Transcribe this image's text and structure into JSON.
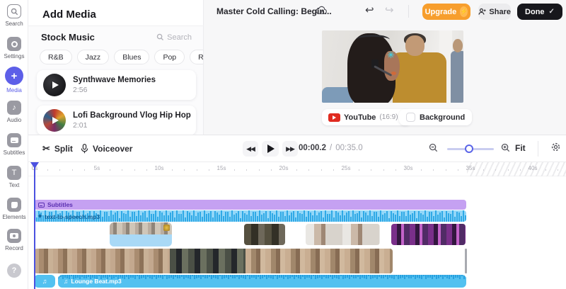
{
  "sidebar": {
    "items": [
      {
        "label": "Search"
      },
      {
        "label": "Settings"
      },
      {
        "label": "Media"
      },
      {
        "label": "Audio"
      },
      {
        "label": "Subtitles"
      },
      {
        "label": "Text"
      },
      {
        "label": "Elements"
      },
      {
        "label": "Record"
      }
    ],
    "help_label": "?"
  },
  "media_panel": {
    "title": "Add Media",
    "section_title": "Stock Music",
    "search_label": "Search",
    "genres": [
      "R&B",
      "Jazz",
      "Blues",
      "Pop",
      "Rock"
    ],
    "more_label": "•••",
    "items": [
      {
        "title": "Synthwave Memories",
        "duration": "2:56"
      },
      {
        "title": "Lofi Background Vlog Hip Hop",
        "duration": "2:01"
      }
    ]
  },
  "header": {
    "project_title": "Master Cold Calling: Begin...",
    "upgrade_label": "Upgrade",
    "upgrade_bolt": "⚡",
    "share_label": "Share",
    "done_label": "Done",
    "done_check": "✓",
    "undo_glyph": "↩",
    "redo_glyph": "↪"
  },
  "preview": {
    "format_label": "YouTube",
    "aspect_label": "(16:9)",
    "chevron": "▾",
    "background_label": "Background",
    "sticker_glyph": "✳"
  },
  "timeline": {
    "split_label": "Split",
    "split_icon": "✂",
    "voiceover_label": "Voiceover",
    "rewind_glyph": "◀◀",
    "forward_glyph": "▶▶",
    "current_time": "00:00.2",
    "time_separator": "/",
    "total_time": "00:35.0",
    "fit_label": "Fit",
    "ruler_labels": [
      "0s",
      "5s",
      "10s",
      "15s",
      "20s",
      "25s",
      "30s",
      "35s",
      "40s"
    ],
    "tracks": {
      "subtitles_label": "Subtitles",
      "tts_sparkle": "✦",
      "tts_label": "text-to-speech.mp3",
      "music_note": "♫",
      "music_label": "Lounge Beat.mp3"
    }
  },
  "colors": {
    "accent": "#5d5fe8",
    "upgrade_orange": "#f79e2d",
    "timeline_blue": "#53c1f0",
    "subtitle_purple": "#c5a1f2",
    "playhead": "#4b51e0"
  }
}
